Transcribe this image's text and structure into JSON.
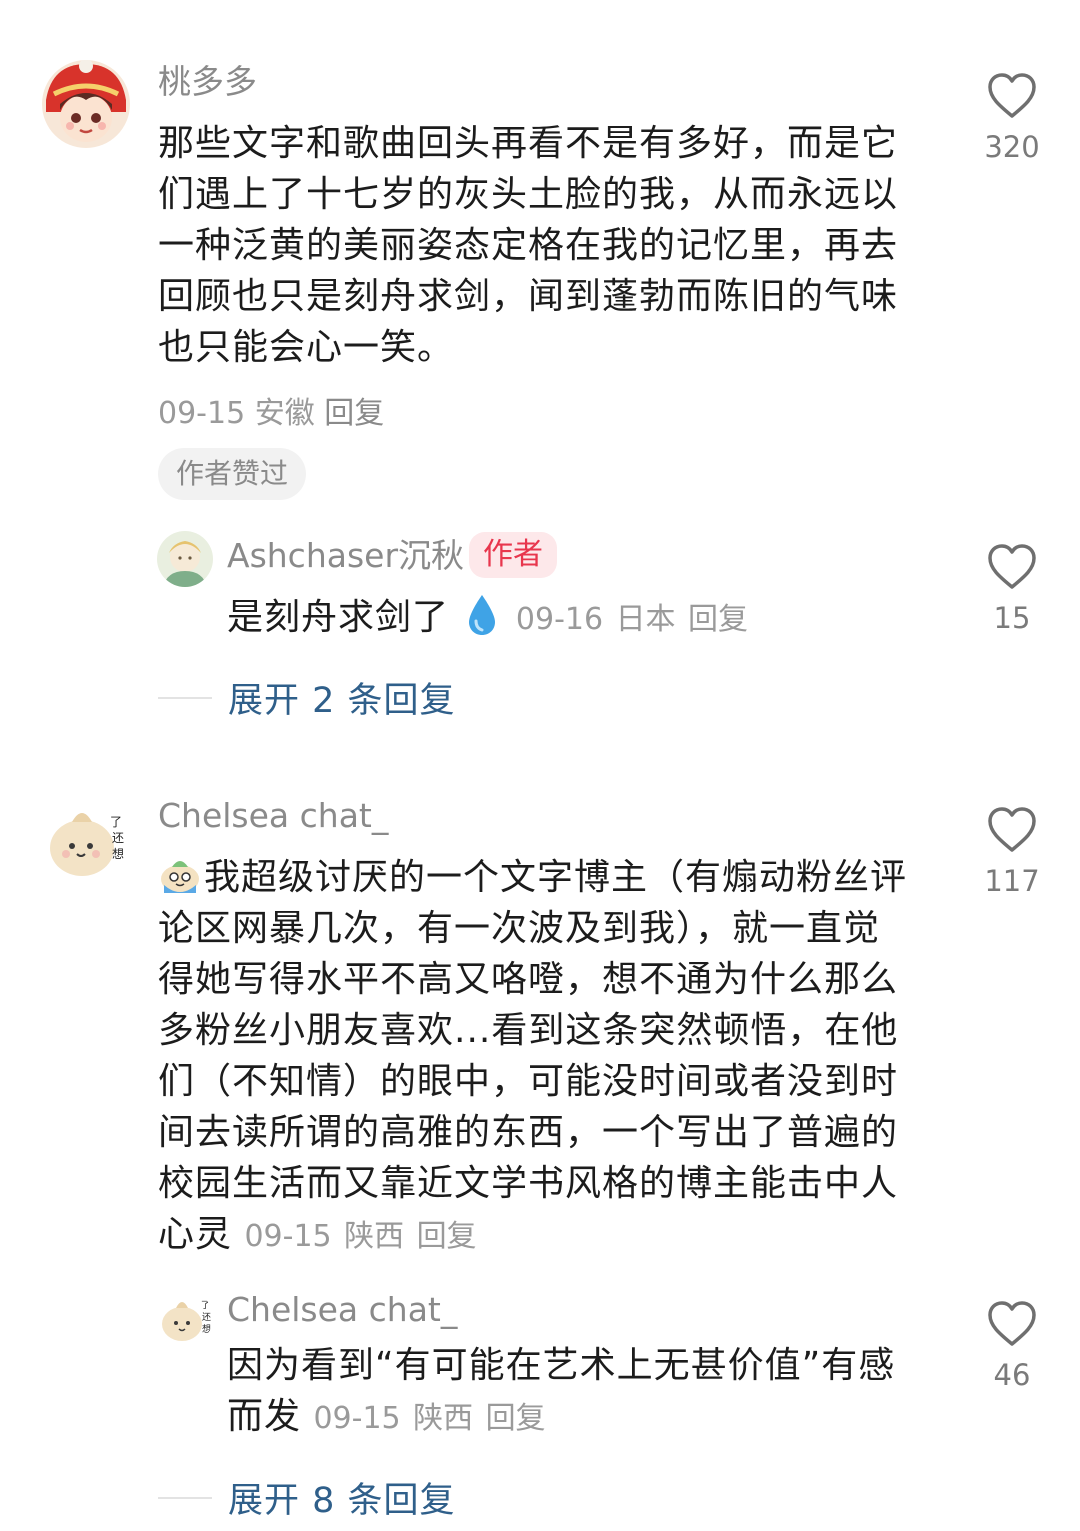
{
  "comments": [
    {
      "username": "桃多多",
      "content": "那些文字和歌曲回头再看不是有多好，而是它们遇上了十七岁的灰头土脸的我，从而永远以一种泛黄的美丽姿态定格在我的记忆里，再去回顾也只是刻舟求剑，闻到蓬勃而陈旧的气味也只能会心一笑。",
      "date": "09-15",
      "location": "安徽",
      "reply_label": "回复",
      "badge": "作者赞过",
      "likes": "320",
      "sub_reply": {
        "username": "Ashchaser沉秋",
        "tag": "作者",
        "content": "是刻舟求剑了",
        "emoji": "droplet-emoji",
        "date": "09-16",
        "location": "日本",
        "reply_label": "回复",
        "likes": "15"
      },
      "expand_label": "展开 2 条回复"
    },
    {
      "username": "Chelsea chat_",
      "content": "我超级讨厌的一个文字博主（有煽动粉丝评论区网暴几次，有一次波及到我），就一直觉得她写得水平不高又咯噔，想不通为什么那么多粉丝小朋友喜欢...看到这条突然顿悟，在他们（不知情）的眼中，可能没时间或者没到时间去读所谓的高雅的东西，一个写出了普遍的校园生活而又靠近文学书风格的博主能击中人心灵",
      "emoji": "crying-blob-emoji",
      "date": "09-15",
      "location": "陕西",
      "reply_label": "回复",
      "likes": "117",
      "sub_reply": {
        "username": "Chelsea chat_",
        "content": "因为看到“有可能在艺术上无甚价值”有感而发",
        "date": "09-15",
        "location": "陕西",
        "reply_label": "回复",
        "likes": "46"
      },
      "expand_label": "展开 8 条回复"
    }
  ],
  "colors": {
    "link_blue": "#2f5f8a",
    "author_tag_bg": "#fde8ea",
    "author_tag_text": "#e8364d",
    "muted": "#8a8a8a"
  }
}
